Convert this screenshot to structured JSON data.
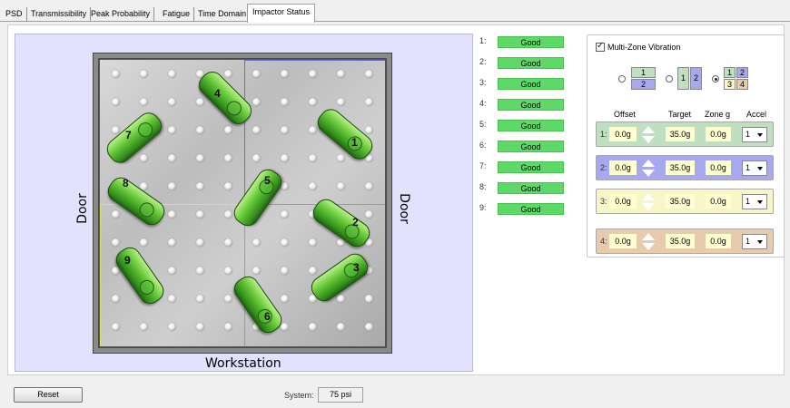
{
  "tabs": [
    "PSD",
    "Transmissibility",
    "Peak Probability",
    "Fatigue",
    "Time Domain",
    "Impactor Status"
  ],
  "active_tab": "Impactor Status",
  "table": {
    "left_label": "Door",
    "right_label": "Door",
    "bottom_label": "Workstation",
    "impactors": [
      "1",
      "2",
      "3",
      "4",
      "5",
      "6",
      "7",
      "8",
      "9"
    ]
  },
  "status": [
    {
      "num": "1:",
      "value": "Good"
    },
    {
      "num": "2:",
      "value": "Good"
    },
    {
      "num": "3:",
      "value": "Good"
    },
    {
      "num": "4:",
      "value": "Good"
    },
    {
      "num": "5:",
      "value": "Good"
    },
    {
      "num": "6:",
      "value": "Good"
    },
    {
      "num": "7:",
      "value": "Good"
    },
    {
      "num": "8:",
      "value": "Good"
    },
    {
      "num": "9:",
      "value": "Good"
    }
  ],
  "multizone": {
    "label": "Multi-Zone Vibration",
    "checked": true,
    "layout_options": {
      "opt1": [
        "1",
        "2"
      ],
      "opt2": [
        "1",
        "2"
      ],
      "opt3": [
        "1",
        "2",
        "3",
        "4"
      ]
    },
    "selected_layout": 3,
    "columns": {
      "offset": "Offset",
      "target": "Target",
      "zone_g": "Zone g",
      "accel": "Accel"
    },
    "zones": [
      {
        "num": "1:",
        "offset": "0.0g",
        "target": "35.0g",
        "zone_g": "0.0g",
        "accel": "1",
        "color": "#bfe0c0",
        "spin": "#ffffff"
      },
      {
        "num": "2:",
        "offset": "0.0g",
        "target": "35.0g",
        "zone_g": "0.0g",
        "accel": "1",
        "color": "#a8a8ee",
        "spin": "#ffffff"
      },
      {
        "num": "3:",
        "offset": "0.0g",
        "target": "35.0g",
        "zone_g": "0.0g",
        "accel": "1",
        "color": "#f6f6c8",
        "spin": "#ffffff"
      },
      {
        "num": "4:",
        "offset": "0.0g",
        "target": "35.0g",
        "zone_g": "0.0g",
        "accel": "1",
        "color": "#e8caac",
        "spin": "#ffffff"
      }
    ]
  },
  "footer": {
    "reset": "Reset",
    "system_label": "System:",
    "system_value": "75 psi"
  }
}
